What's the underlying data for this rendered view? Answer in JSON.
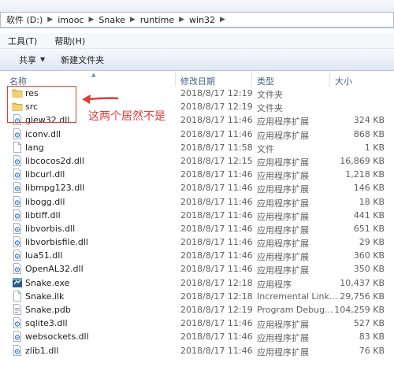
{
  "address": {
    "crumbs": [
      "软件 (D:)",
      "imooc",
      "Snake",
      "runtime",
      "win32"
    ]
  },
  "menu": {
    "tools": "工具(T)",
    "help": "帮助(H)"
  },
  "toolbar": {
    "share": "共享",
    "new_folder": "新建文件夹"
  },
  "columns": {
    "name": "名称",
    "modified": "修改日期",
    "type": "类型",
    "size": "大小"
  },
  "files": [
    {
      "name": "res",
      "date": "2018/8/17 12:19",
      "type": "文件夹",
      "size": "",
      "icon": "folder"
    },
    {
      "name": "src",
      "date": "2018/8/17 12:19",
      "type": "文件夹",
      "size": "",
      "icon": "folder"
    },
    {
      "name": "glew32.dll",
      "date": "2018/8/17 11:46",
      "type": "应用程序扩展",
      "size": "324 KB",
      "icon": "dll"
    },
    {
      "name": "iconv.dll",
      "date": "2018/8/17 11:46",
      "type": "应用程序扩展",
      "size": "868 KB",
      "icon": "dll"
    },
    {
      "name": "lang",
      "date": "2018/8/17 11:58",
      "type": "文件",
      "size": "1 KB",
      "icon": "file"
    },
    {
      "name": "libcocos2d.dll",
      "date": "2018/8/17 12:15",
      "type": "应用程序扩展",
      "size": "16,869 KB",
      "icon": "dll"
    },
    {
      "name": "libcurl.dll",
      "date": "2018/8/17 11:46",
      "type": "应用程序扩展",
      "size": "1,218 KB",
      "icon": "dll"
    },
    {
      "name": "libmpg123.dll",
      "date": "2018/8/17 11:46",
      "type": "应用程序扩展",
      "size": "146 KB",
      "icon": "dll"
    },
    {
      "name": "libogg.dll",
      "date": "2018/8/17 11:46",
      "type": "应用程序扩展",
      "size": "18 KB",
      "icon": "dll"
    },
    {
      "name": "libtiff.dll",
      "date": "2018/8/17 11:46",
      "type": "应用程序扩展",
      "size": "441 KB",
      "icon": "dll"
    },
    {
      "name": "libvorbis.dll",
      "date": "2018/8/17 11:46",
      "type": "应用程序扩展",
      "size": "651 KB",
      "icon": "dll"
    },
    {
      "name": "libvorbisfile.dll",
      "date": "2018/8/17 11:46",
      "type": "应用程序扩展",
      "size": "29 KB",
      "icon": "dll"
    },
    {
      "name": "lua51.dll",
      "date": "2018/8/17 11:46",
      "type": "应用程序扩展",
      "size": "360 KB",
      "icon": "dll"
    },
    {
      "name": "OpenAL32.dll",
      "date": "2018/8/17 11:46",
      "type": "应用程序扩展",
      "size": "350 KB",
      "icon": "dll"
    },
    {
      "name": "Snake.exe",
      "date": "2018/8/17 12:18",
      "type": "应用程序",
      "size": "10,437 KB",
      "icon": "exe"
    },
    {
      "name": "Snake.ilk",
      "date": "2018/8/17 12:18",
      "type": "Incremental Link...",
      "size": "29,756 KB",
      "icon": "file"
    },
    {
      "name": "Snake.pdb",
      "date": "2018/8/17 12:19",
      "type": "Program Debug...",
      "size": "104,259 KB",
      "icon": "pdb"
    },
    {
      "name": "sqlite3.dll",
      "date": "2018/8/17 11:46",
      "type": "应用程序扩展",
      "size": "527 KB",
      "icon": "dll"
    },
    {
      "name": "websockets.dll",
      "date": "2018/8/17 11:46",
      "type": "应用程序扩展",
      "size": "83 KB",
      "icon": "dll"
    },
    {
      "name": "zlib1.dll",
      "date": "2018/8/17 11:46",
      "type": "应用程序扩展",
      "size": "76 KB",
      "icon": "dll"
    }
  ],
  "annotation": {
    "text": "这两个居然不是",
    "color": "#e23b3b"
  },
  "colors": {
    "folder": "#e8c258",
    "accent": "#1e6fc4"
  }
}
